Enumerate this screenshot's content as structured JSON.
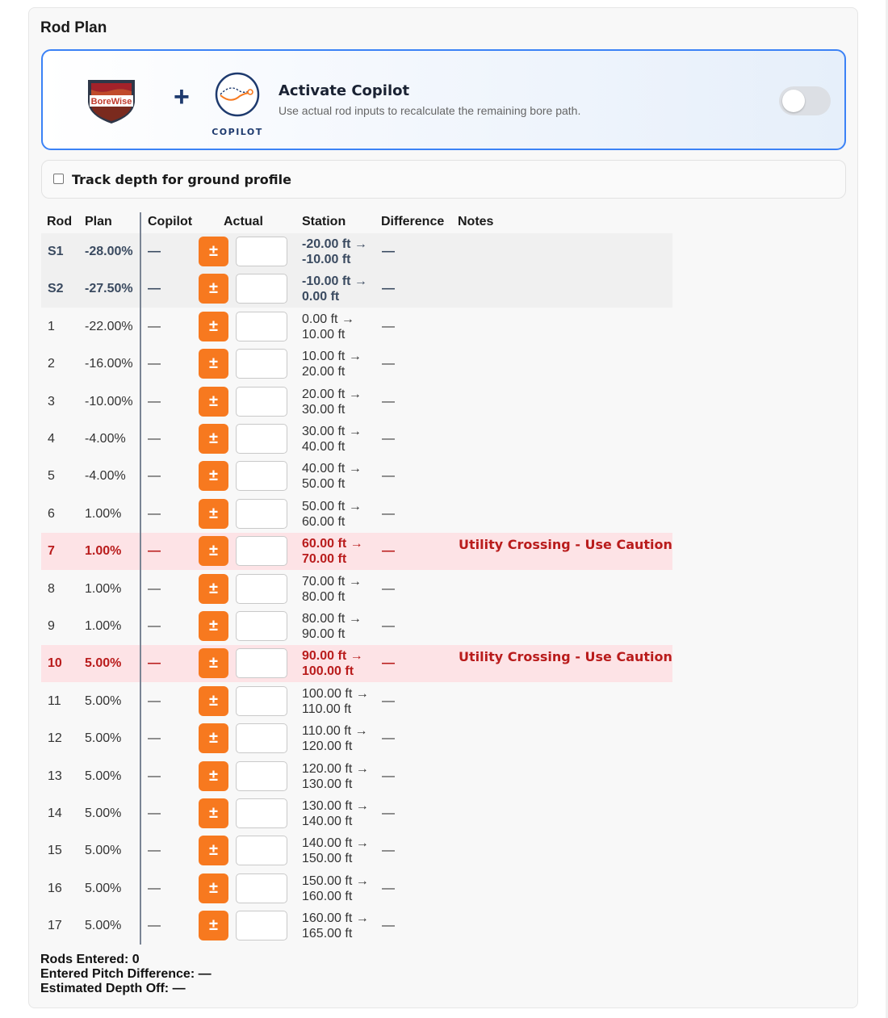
{
  "panel_title": "Rod Plan",
  "copilot": {
    "brand_logo_text": "BoreWise",
    "plus": "+",
    "copilot_logo_text": "COPILOT",
    "title": "Activate Copilot",
    "subtitle": "Use actual rod inputs to recalculate the remaining bore path.",
    "enabled": false
  },
  "track_depth": {
    "label": "Track depth for ground profile",
    "checked": false
  },
  "table": {
    "headers": [
      "Rod",
      "Plan",
      "Copilot",
      "Actual",
      "Station",
      "Difference",
      "Notes"
    ],
    "adjust_label": "±",
    "rows": [
      {
        "rod": "S1",
        "plan": "-28.00%",
        "copilot": "—",
        "station_from": "-20.00 ft →",
        "station_to": "-10.00 ft",
        "difference": "—",
        "notes": "",
        "kind": "seg"
      },
      {
        "rod": "S2",
        "plan": "-27.50%",
        "copilot": "—",
        "station_from": "-10.00 ft →",
        "station_to": "0.00 ft",
        "difference": "—",
        "notes": "",
        "kind": "seg"
      },
      {
        "rod": "1",
        "plan": "-22.00%",
        "copilot": "—",
        "station_from": "0.00 ft →",
        "station_to": "10.00 ft",
        "difference": "—",
        "notes": "",
        "kind": ""
      },
      {
        "rod": "2",
        "plan": "-16.00%",
        "copilot": "—",
        "station_from": "10.00 ft →",
        "station_to": "20.00 ft",
        "difference": "—",
        "notes": "",
        "kind": ""
      },
      {
        "rod": "3",
        "plan": "-10.00%",
        "copilot": "—",
        "station_from": "20.00 ft →",
        "station_to": "30.00 ft",
        "difference": "—",
        "notes": "",
        "kind": ""
      },
      {
        "rod": "4",
        "plan": "-4.00%",
        "copilot": "—",
        "station_from": "30.00 ft →",
        "station_to": "40.00 ft",
        "difference": "—",
        "notes": "",
        "kind": ""
      },
      {
        "rod": "5",
        "plan": "-4.00%",
        "copilot": "—",
        "station_from": "40.00 ft →",
        "station_to": "50.00 ft",
        "difference": "—",
        "notes": "",
        "kind": ""
      },
      {
        "rod": "6",
        "plan": "1.00%",
        "copilot": "—",
        "station_from": "50.00 ft →",
        "station_to": "60.00 ft",
        "difference": "—",
        "notes": "",
        "kind": ""
      },
      {
        "rod": "7",
        "plan": "1.00%",
        "copilot": "—",
        "station_from": "60.00 ft →",
        "station_to": "70.00 ft",
        "difference": "—",
        "notes": "Utility Crossing - Use Caution",
        "kind": "warn"
      },
      {
        "rod": "8",
        "plan": "1.00%",
        "copilot": "—",
        "station_from": "70.00 ft →",
        "station_to": "80.00 ft",
        "difference": "—",
        "notes": "",
        "kind": ""
      },
      {
        "rod": "9",
        "plan": "1.00%",
        "copilot": "—",
        "station_from": "80.00 ft →",
        "station_to": "90.00 ft",
        "difference": "—",
        "notes": "",
        "kind": ""
      },
      {
        "rod": "10",
        "plan": "5.00%",
        "copilot": "—",
        "station_from": "90.00 ft →",
        "station_to": "100.00 ft",
        "difference": "—",
        "notes": "Utility Crossing - Use Caution",
        "kind": "warn"
      },
      {
        "rod": "11",
        "plan": "5.00%",
        "copilot": "—",
        "station_from": "100.00 ft →",
        "station_to": "110.00 ft",
        "difference": "—",
        "notes": "",
        "kind": ""
      },
      {
        "rod": "12",
        "plan": "5.00%",
        "copilot": "—",
        "station_from": "110.00 ft →",
        "station_to": "120.00 ft",
        "difference": "—",
        "notes": "",
        "kind": ""
      },
      {
        "rod": "13",
        "plan": "5.00%",
        "copilot": "—",
        "station_from": "120.00 ft →",
        "station_to": "130.00 ft",
        "difference": "—",
        "notes": "",
        "kind": ""
      },
      {
        "rod": "14",
        "plan": "5.00%",
        "copilot": "—",
        "station_from": "130.00 ft →",
        "station_to": "140.00 ft",
        "difference": "—",
        "notes": "",
        "kind": ""
      },
      {
        "rod": "15",
        "plan": "5.00%",
        "copilot": "—",
        "station_from": "140.00 ft →",
        "station_to": "150.00 ft",
        "difference": "—",
        "notes": "",
        "kind": ""
      },
      {
        "rod": "16",
        "plan": "5.00%",
        "copilot": "—",
        "station_from": "150.00 ft →",
        "station_to": "160.00 ft",
        "difference": "—",
        "notes": "",
        "kind": ""
      },
      {
        "rod": "17",
        "plan": "5.00%",
        "copilot": "—",
        "station_from": "160.00 ft →",
        "station_to": "165.00 ft",
        "difference": "—",
        "notes": "",
        "kind": ""
      }
    ]
  },
  "summary": {
    "rods_entered": "Rods Entered: 0",
    "pitch_difference": "Entered Pitch Difference: —",
    "depth_off": "Estimated Depth Off: —"
  },
  "colors": {
    "accent": "#3b82f6",
    "adjust_button": "#f7791f",
    "warning_text": "#b91c1c",
    "warning_row": "#fde3e6"
  }
}
